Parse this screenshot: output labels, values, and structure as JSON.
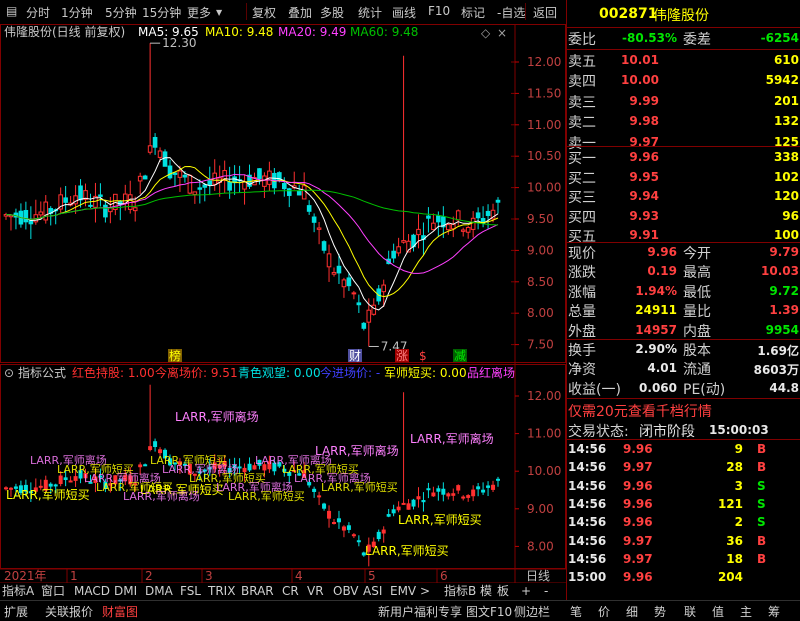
{
  "toolbar": {
    "items": [
      "分时",
      "1分钟",
      "5分钟",
      "15分钟",
      "更多",
      "复权",
      "叠加",
      "多股",
      "统计",
      "画线",
      "F10",
      "标记",
      "-自选",
      "返回"
    ]
  },
  "main_chart": {
    "title": "伟隆股份(日线 前复权)",
    "ma5_label": "MA5: 9.65",
    "ma10_label": "MA10: 9.48",
    "ma20_label": "MA20: 9.49",
    "ma60_label": "MA60: 9.48",
    "high_marker": "12.30",
    "low_marker": "7.47",
    "axis_ticks": [
      "12.00",
      "11.50",
      "11.00",
      "10.50",
      "10.00",
      "9.50",
      "9.00",
      "8.50",
      "8.00",
      "7.50"
    ],
    "event_badges": [
      "榜",
      "财",
      "涨",
      "$",
      "减"
    ]
  },
  "indicator_chart": {
    "name": "指标公式",
    "legend": [
      {
        "text": "红色持股: 1.00",
        "color": "#ff3030"
      },
      {
        "text": "今离场价: 9.51",
        "color": "#ff3030"
      },
      {
        "text": "青色观望: 0.00",
        "color": "#00e0e0"
      },
      {
        "text": "今进场价: -",
        "color": "#4040ff"
      },
      {
        "text": "军师短买: 0.00",
        "color": "#ffff00"
      },
      {
        "text": "品红离场",
        "color": "#ff40ff"
      }
    ],
    "axis_ticks": [
      "12.00",
      "11.00",
      "10.00",
      "9.00",
      "8.00"
    ],
    "annotations": [
      "LARR,军师离场",
      "LARR,军师离场",
      "LARR,军师离场",
      "LARR,军师短买",
      "LARR,军师短买",
      "LARR,军师短买",
      "LARR,军师短买"
    ]
  },
  "time_axis": {
    "labels": [
      "2021年",
      "1",
      "2",
      "3",
      "4",
      "5",
      "6"
    ],
    "unit_label": "日线"
  },
  "bottom_tabs": [
    "指标A",
    "窗口",
    "MACD",
    "DMI",
    "DMA",
    "FSL",
    "TRIX",
    "BRAR",
    "CR",
    "VR",
    "OBV",
    "ASI",
    "EMV",
    "指标B",
    "模",
    "板",
    "+",
    "-"
  ],
  "status_bar": {
    "left": [
      "扩展",
      "关联报价",
      "财富图"
    ],
    "right": [
      "新用户福利专享",
      "图文F10",
      "侧边栏",
      "笔",
      "价",
      "细",
      "势",
      "联",
      "值",
      "主",
      "筹"
    ]
  },
  "quote": {
    "code": "002871",
    "name": "伟隆股份",
    "weibi_label": "委比",
    "weibi_value": "-80.53%",
    "weicha_label": "委差",
    "weicha_value": "-6254",
    "asks": [
      {
        "label": "卖五",
        "price": "10.01",
        "vol": "610"
      },
      {
        "label": "卖四",
        "price": "10.00",
        "vol": "5942"
      },
      {
        "label": "卖三",
        "price": "9.99",
        "vol": "201"
      },
      {
        "label": "卖二",
        "price": "9.98",
        "vol": "132"
      },
      {
        "label": "卖一",
        "price": "9.97",
        "vol": "125"
      }
    ],
    "bids": [
      {
        "label": "买一",
        "price": "9.96",
        "vol": "338"
      },
      {
        "label": "买二",
        "price": "9.95",
        "vol": "102"
      },
      {
        "label": "买三",
        "price": "9.94",
        "vol": "120"
      },
      {
        "label": "买四",
        "price": "9.93",
        "vol": "96"
      },
      {
        "label": "买五",
        "price": "9.91",
        "vol": "100"
      }
    ],
    "stats": [
      {
        "l1": "现价",
        "v1": "9.96",
        "c1": "red",
        "l2": "今开",
        "v2": "9.79",
        "c2": "red"
      },
      {
        "l1": "涨跌",
        "v1": "0.19",
        "c1": "red",
        "l2": "最高",
        "v2": "10.03",
        "c2": "red"
      },
      {
        "l1": "涨幅",
        "v1": "1.94%",
        "c1": "red",
        "l2": "最低",
        "v2": "9.72",
        "c2": "green"
      },
      {
        "l1": "总量",
        "v1": "24911",
        "c1": "yellow",
        "l2": "量比",
        "v2": "1.39",
        "c2": "red"
      },
      {
        "l1": "外盘",
        "v1": "14957",
        "c1": "red",
        "l2": "内盘",
        "v2": "9954",
        "c2": "green"
      }
    ],
    "stats2": [
      {
        "l1": "换手",
        "v1": "2.90%",
        "l2": "股本",
        "v2": "1.69亿"
      },
      {
        "l1": "净资",
        "v1": "4.01",
        "l2": "流通",
        "v2": "8603万"
      },
      {
        "l1": "收益(一)",
        "v1": "0.060",
        "l2": "PE(动)",
        "v2": "44.8"
      }
    ],
    "promo": "仅需20元查看千档行情",
    "trade_status_label": "交易状态:",
    "trade_status_value": "闭市阶段",
    "trade_status_time": "15:00:03",
    "ticks": [
      {
        "time": "14:56",
        "price": "9.96",
        "vol": "9",
        "side": "B",
        "sc": "red"
      },
      {
        "time": "14:56",
        "price": "9.97",
        "vol": "28",
        "side": "B",
        "sc": "red"
      },
      {
        "time": "14:56",
        "price": "9.96",
        "vol": "3",
        "side": "S",
        "sc": "green"
      },
      {
        "time": "14:56",
        "price": "9.96",
        "vol": "121",
        "side": "S",
        "sc": "green"
      },
      {
        "time": "14:56",
        "price": "9.96",
        "vol": "2",
        "side": "S",
        "sc": "green"
      },
      {
        "time": "14:56",
        "price": "9.97",
        "vol": "36",
        "side": "B",
        "sc": "red"
      },
      {
        "time": "14:56",
        "price": "9.97",
        "vol": "18",
        "side": "B",
        "sc": "red"
      },
      {
        "time": "15:00",
        "price": "9.96",
        "vol": "204",
        "side": "",
        "sc": "white"
      }
    ]
  },
  "colors": {
    "up": "#ff3030",
    "down": "#00e0e0",
    "ma5": "#ffffff",
    "ma10": "#ffff00",
    "ma20": "#ff40ff",
    "ma60": "#00c000",
    "grid": "#800000"
  }
}
